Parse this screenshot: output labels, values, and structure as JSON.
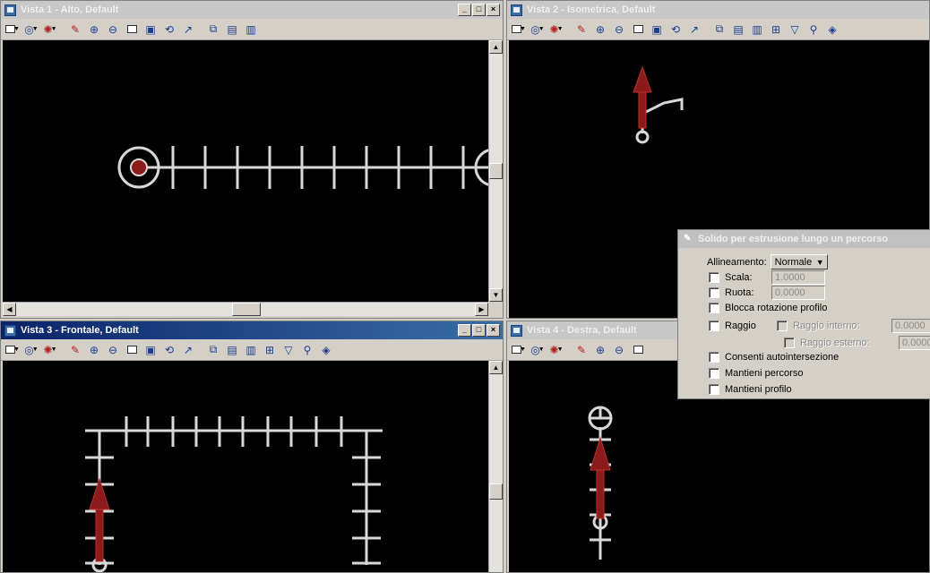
{
  "views": [
    {
      "title": "Vista 1 - Alto, Default",
      "active": false
    },
    {
      "title": "Vista 2 - Isometrica, Default",
      "active": false
    },
    {
      "title": "Vista 3 - Frontale, Default",
      "active": true
    },
    {
      "title": "Vista 4 - Destra, Default",
      "active": false
    }
  ],
  "window_buttons": {
    "minimize": "_",
    "restore": "□",
    "close": "×"
  },
  "dialog": {
    "title": "Solido per estrusione lungo un percorso",
    "allineamento_label": "Allineamento:",
    "allineamento_value": "Normale",
    "scala_label": "Scala:",
    "scala_value": "1.0000",
    "ruota_label": "Ruota:",
    "ruota_value": "0.0000",
    "blocca_label": "Blocca rotazione profilo",
    "raggio_label": "Raggio",
    "raggio_interno_label": "Raggio interno:",
    "raggio_interno_value": "0.0000",
    "raggio_esterno_label": "Raggio esterno:",
    "raggio_esterno_value": "0.0000",
    "consenti_label": "Consenti autointersezione",
    "mantieni_percorso_label": "Mantieni percorso",
    "mantieni_profilo_label": "Mantieni profilo"
  },
  "colors": {
    "canvas": "#000000",
    "path": "#d8d8d8",
    "profile": "#8b1a1a",
    "active_title": "#0a246a"
  },
  "icons": [
    "view-attributes-icon",
    "levels-icon",
    "lights-icon",
    "zoom-in-icon",
    "zoom-out-icon",
    "window-area-icon",
    "fit-view-icon",
    "rotate-view-icon",
    "pan-icon",
    "view-previous-icon",
    "view-next-icon",
    "clip-icon",
    "render-icon"
  ]
}
